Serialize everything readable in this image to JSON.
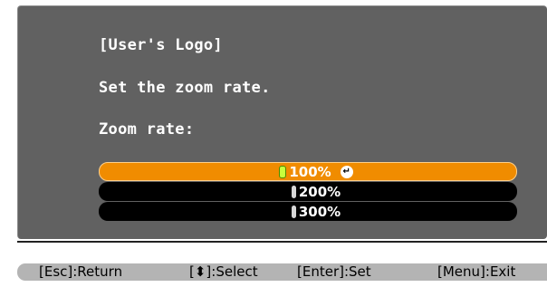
{
  "dialog": {
    "title": "[User's Logo]",
    "prompt": "Set the zoom rate.",
    "field_label": "Zoom rate:"
  },
  "options": [
    {
      "label": "100%",
      "selected": true
    },
    {
      "label": "200%",
      "selected": false
    },
    {
      "label": "300%",
      "selected": false
    }
  ],
  "help": {
    "return": "[Esc]:Return",
    "select": "[⬍]:Select",
    "set": "[Enter]:Set",
    "exit": "[Menu]:Exit"
  },
  "colors": {
    "panel": "#616161",
    "selected_bg": "#f08c00",
    "option_bg": "#000000",
    "helpbar_bg": "#b4b4b4"
  }
}
